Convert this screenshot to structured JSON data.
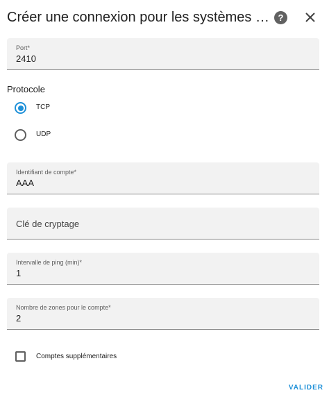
{
  "dialog": {
    "title": "Créer une connexion pour les systèmes d'alarme",
    "help_icon": "question-circle-icon",
    "help_glyph": "?",
    "close_icon": "close-icon"
  },
  "port": {
    "label": "Port*",
    "value": "2410"
  },
  "protocol": {
    "label": "Protocole",
    "options": [
      {
        "label": "TCP",
        "selected": true
      },
      {
        "label": "UDP",
        "selected": false
      }
    ]
  },
  "account_id": {
    "label": "Identifiant de compte*",
    "value": "AAA"
  },
  "encryption_key": {
    "placeholder": "Clé de cryptage",
    "value": ""
  },
  "ping_interval": {
    "label": "Intervalle de ping (min)*",
    "value": "1"
  },
  "zone_count": {
    "label": "Nombre de zones pour le compte*",
    "value": "2"
  },
  "extra_accounts": {
    "label": "Comptes supplémentaires",
    "checked": false
  },
  "actions": {
    "submit_label": "VALIDER"
  },
  "colors": {
    "accent": "#1e90d8",
    "field_bg": "#f2f2f2",
    "text": "#212121"
  }
}
